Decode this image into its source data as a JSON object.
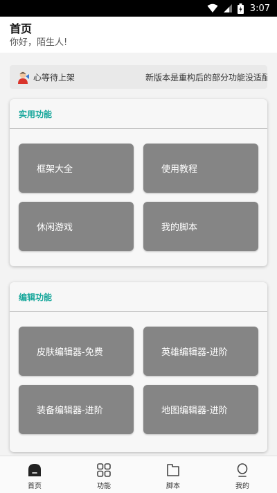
{
  "status_bar": {
    "time": "3:07"
  },
  "header": {
    "title": "首页",
    "greeting": "你好，陌生人!"
  },
  "notice": {
    "left_text": "心等待上架",
    "right_text": "新版本是重构后的部分功能没适配"
  },
  "sections": [
    {
      "title": "实用功能",
      "buttons": [
        "框架大全",
        "使用教程",
        "休闲游戏",
        "我的脚本"
      ]
    },
    {
      "title": "编辑功能",
      "buttons": [
        "皮肤编辑器-免费",
        "英雄编辑器-进阶",
        "装备编辑器-进阶",
        "地图编辑器-进阶"
      ]
    }
  ],
  "bottom_nav": [
    {
      "label": "首页",
      "icon": "home-icon",
      "active": true
    },
    {
      "label": "功能",
      "icon": "grid-icon",
      "active": false
    },
    {
      "label": "脚本",
      "icon": "folder-icon",
      "active": false
    },
    {
      "label": "我的",
      "icon": "profile-icon",
      "active": false
    }
  ],
  "colors": {
    "accent": "#19a89c",
    "button_bg": "#858585"
  }
}
